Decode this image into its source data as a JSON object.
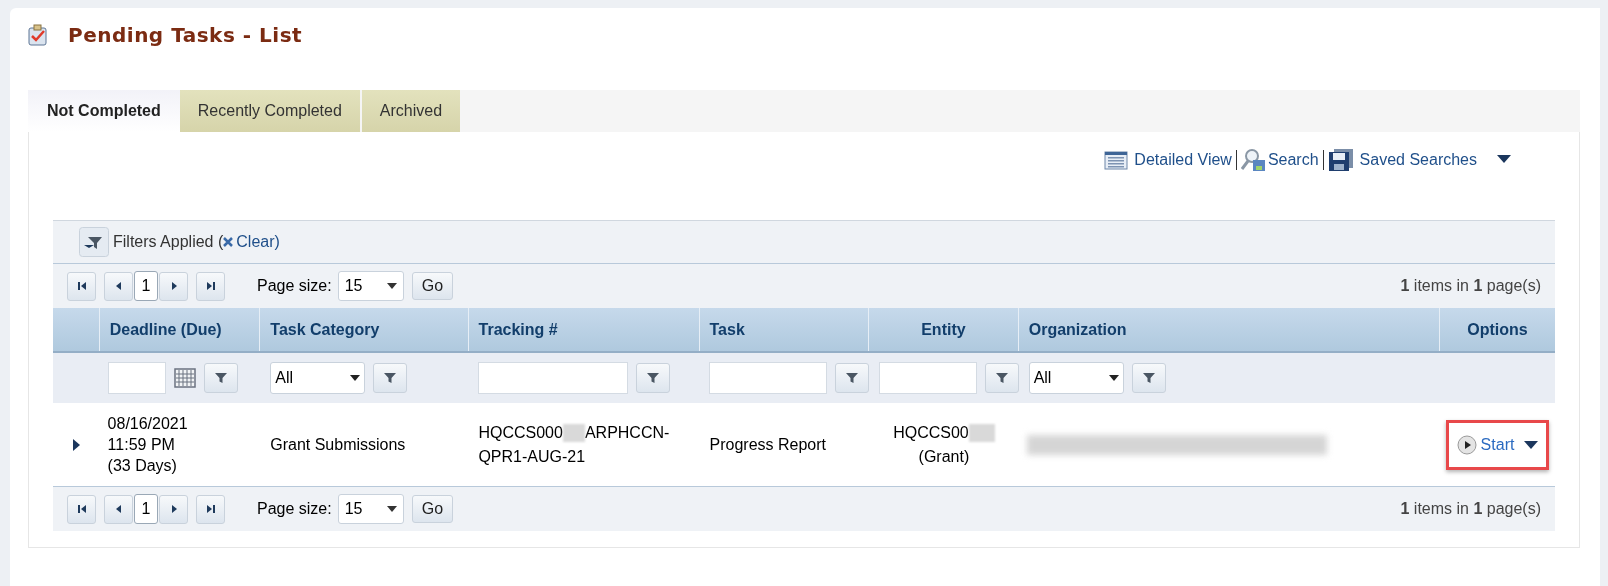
{
  "title": "Pending Tasks - List",
  "tabs": [
    {
      "label": "Not Completed",
      "selected": true
    },
    {
      "label": "Recently Completed",
      "selected": false
    },
    {
      "label": "Archived",
      "selected": false
    }
  ],
  "toolbar": [
    {
      "kind": "list",
      "label": "Detailed View"
    },
    {
      "kind": "search",
      "label": "Search"
    },
    {
      "kind": "save",
      "label": "Saved Searches"
    }
  ],
  "filters": {
    "label": "Filters Applied (",
    "clear": "Clear",
    "closing": ")"
  },
  "pager_top": {
    "page": "1",
    "page_size_label": "Page size:",
    "page_size": "15",
    "go": "Go",
    "summary": "**1** items in **1** page(s)"
  },
  "columns": [
    {
      "kind": "none"
    },
    {
      "label": "Deadline (Due)",
      "kind": "date"
    },
    {
      "label": "Task Category",
      "kind": "select",
      "value": "All"
    },
    {
      "label": "Tracking #",
      "kind": "text"
    },
    {
      "label": "Task",
      "kind": "text"
    },
    {
      "label": "Entity",
      "kind": "text"
    },
    {
      "label": "Organization",
      "kind": "select",
      "value": "All"
    },
    {
      "label": "Options",
      "kind": "none"
    }
  ],
  "rows": [
    {
      "expanded": false,
      "deadline": [
        "08/16/2021",
        "11:59 PM",
        "(33 Days)"
      ],
      "category": "Grant Submissions",
      "tracking": {
        "before": "HQCCS000",
        "after": [
          "ARPHCCN-",
          "QPR1-AUG-21"
        ]
      },
      "task": "Progress Report",
      "entity": {
        "before": "HQCCS00",
        "after": "(Grant)"
      },
      "action": "Start",
      "highlighted": true
    }
  ],
  "pager_bottom": {
    "page": "1",
    "page_size_label": "Page size:",
    "page_size": "15",
    "go": "Go",
    "summary": "**1** items in **1** page(s)"
  }
}
